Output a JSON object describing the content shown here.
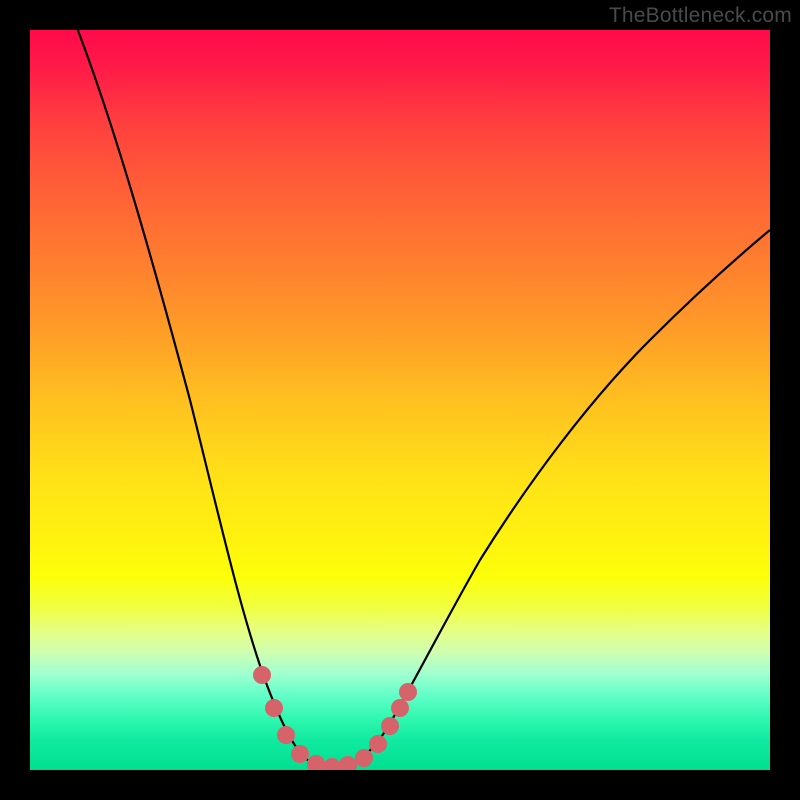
{
  "watermark": "TheBottleneck.com",
  "chart_data": {
    "type": "line",
    "title": "",
    "xlabel": "",
    "ylabel": "",
    "xlim": [
      0,
      100
    ],
    "ylim": [
      0,
      100
    ],
    "x": [
      0,
      3,
      6,
      10,
      14,
      18,
      22,
      26,
      29,
      31,
      33,
      35,
      37,
      40,
      43,
      46,
      50,
      55,
      60,
      65,
      70,
      75,
      80,
      85,
      90,
      95,
      100
    ],
    "values": [
      110,
      100,
      90,
      78,
      66,
      54,
      42,
      30,
      20,
      13,
      8,
      4,
      2,
      1,
      1,
      3,
      7,
      13,
      20,
      27,
      34,
      41,
      47,
      53,
      58,
      63,
      67
    ],
    "marker_points_x": [
      29,
      31,
      33,
      35,
      37,
      40,
      43,
      46
    ],
    "marker_points_y": [
      20,
      13,
      8,
      4,
      2,
      1,
      1,
      3
    ],
    "note": "Bottleneck-style curve: axes hidden; x is normalized position, y is bottleneck percentage (0 = optimal, green band at bottom)."
  }
}
